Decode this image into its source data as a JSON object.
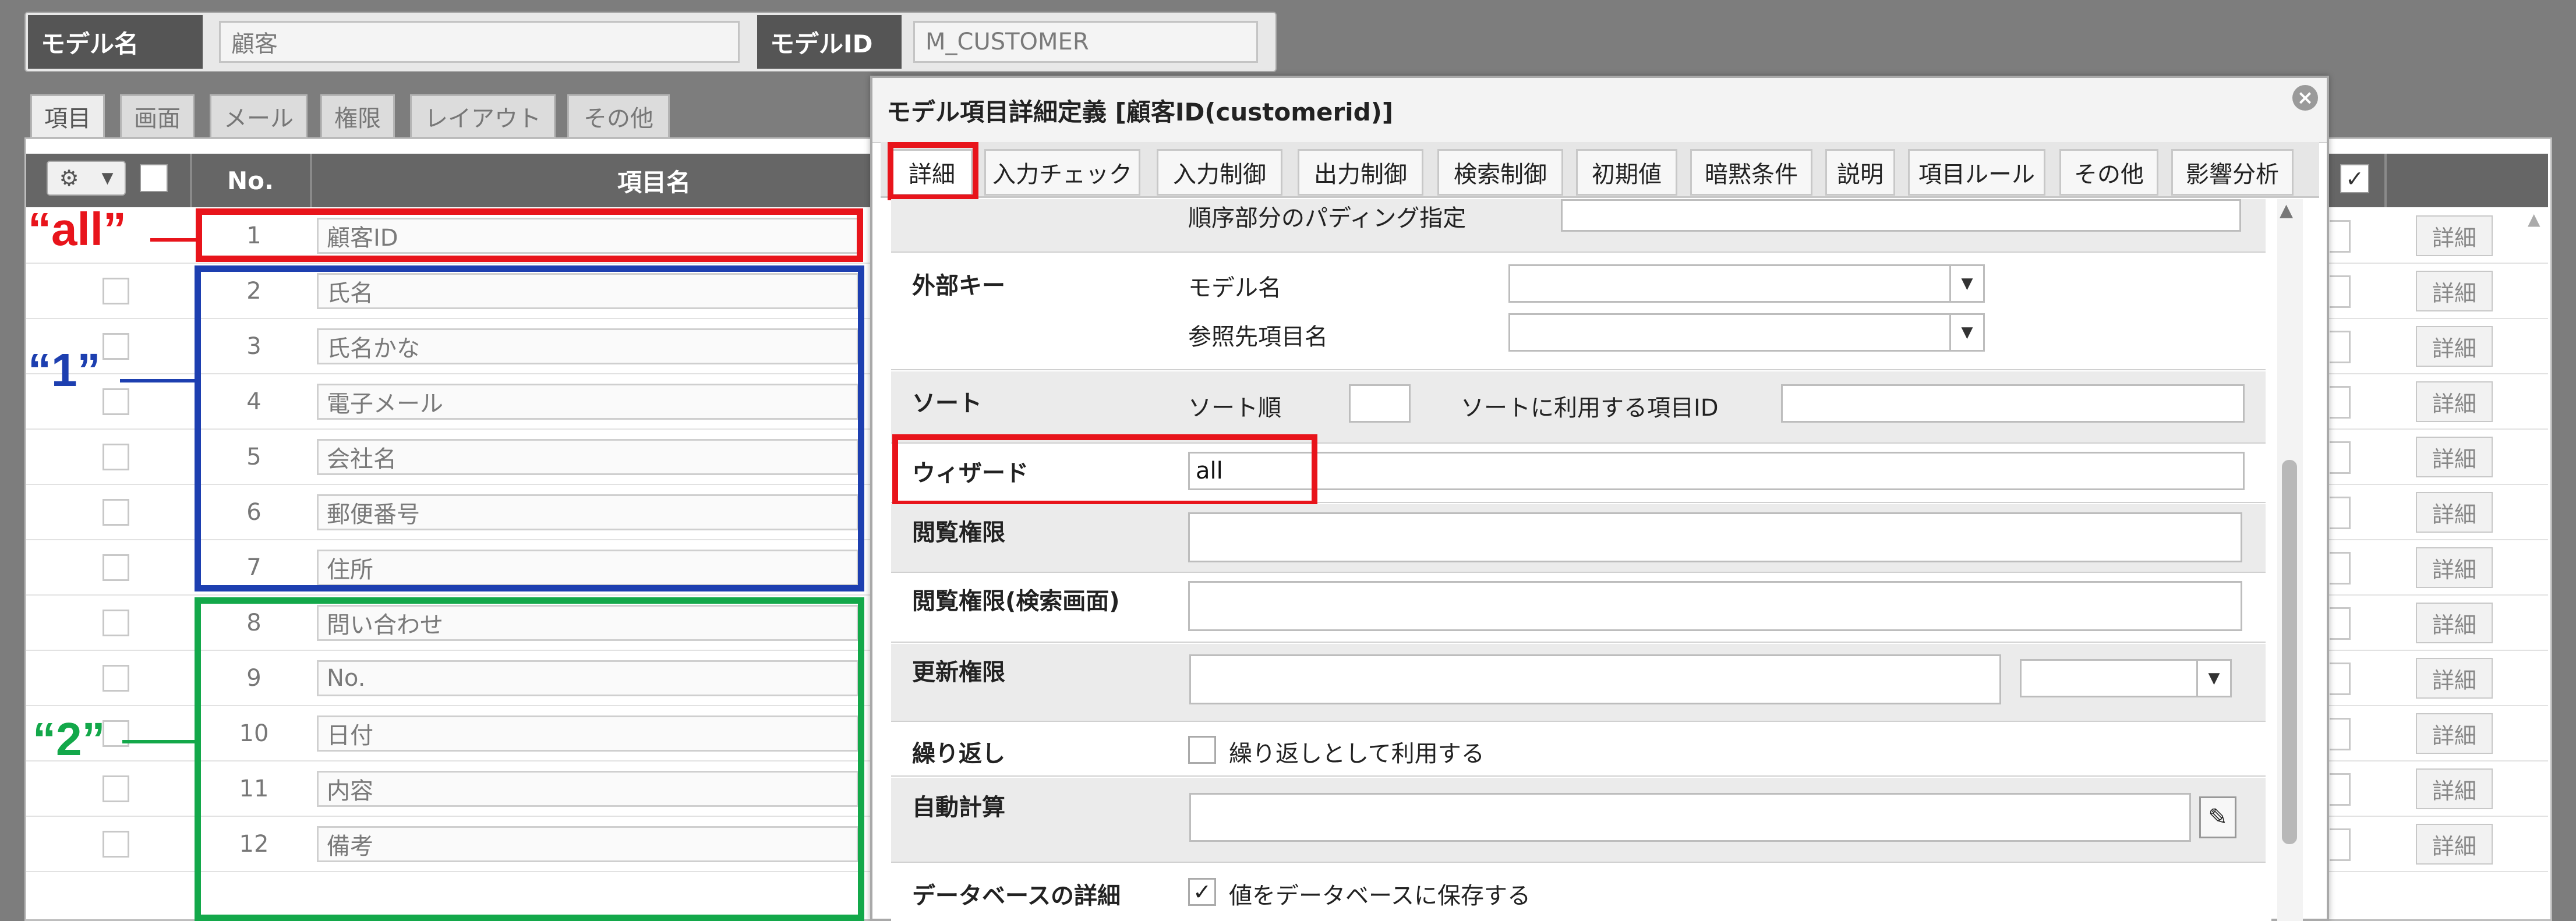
{
  "header": {
    "model_name_label": "モデル名",
    "model_name_value": "顧客",
    "model_id_label": "モデルID",
    "model_id_value": "M_CUSTOMER"
  },
  "tabs": [
    "項目",
    "画面",
    "メール",
    "権限",
    "レイアウト",
    "その他"
  ],
  "table": {
    "col_no": "No.",
    "col_name": "項目名",
    "detail_label": "詳細",
    "rows": [
      {
        "no": "1",
        "name": "顧客ID"
      },
      {
        "no": "2",
        "name": "氏名"
      },
      {
        "no": "3",
        "name": "氏名かな"
      },
      {
        "no": "4",
        "name": "電子メール"
      },
      {
        "no": "5",
        "name": "会社名"
      },
      {
        "no": "6",
        "name": "郵便番号"
      },
      {
        "no": "7",
        "name": "住所"
      },
      {
        "no": "8",
        "name": "問い合わせ"
      },
      {
        "no": "9",
        "name": "No."
      },
      {
        "no": "10",
        "name": "日付"
      },
      {
        "no": "11",
        "name": "内容"
      },
      {
        "no": "12",
        "name": "備考"
      }
    ]
  },
  "annotations": {
    "all": "“all”",
    "one": "“1”",
    "two": "“2”",
    "colors": {
      "red": "#e8141b",
      "blue": "#1d3fb0",
      "green": "#13a84a"
    }
  },
  "dialog": {
    "title": "モデル項目詳細定義 [顧客ID(customerid)]",
    "close_icon": "×",
    "tabs": [
      "詳細",
      "入力チェック",
      "入力制御",
      "出力制御",
      "検索制御",
      "初期値",
      "暗黙条件",
      "説明",
      "項目ルール",
      "その他",
      "影響分析"
    ],
    "padding_label": "順序部分のパディング指定",
    "foreign_key": {
      "label": "外部キー",
      "model_name": "モデル名",
      "ref_item": "参照先項目名"
    },
    "sort": {
      "label": "ソート",
      "order": "ソート順",
      "item_id": "ソートに利用する項目ID"
    },
    "wizard": {
      "label": "ウィザード",
      "value": "all"
    },
    "view_perm": "閲覧権限",
    "view_perm_search": "閲覧権限(検索画面)",
    "update_perm": "更新権限",
    "repeat": {
      "label": "繰り返し",
      "checkbox": "繰り返しとして利用する"
    },
    "auto_calc": "自動計算",
    "db_detail": {
      "label": "データベースの詳細",
      "checkbox": "値をデータベースに保存する"
    }
  }
}
